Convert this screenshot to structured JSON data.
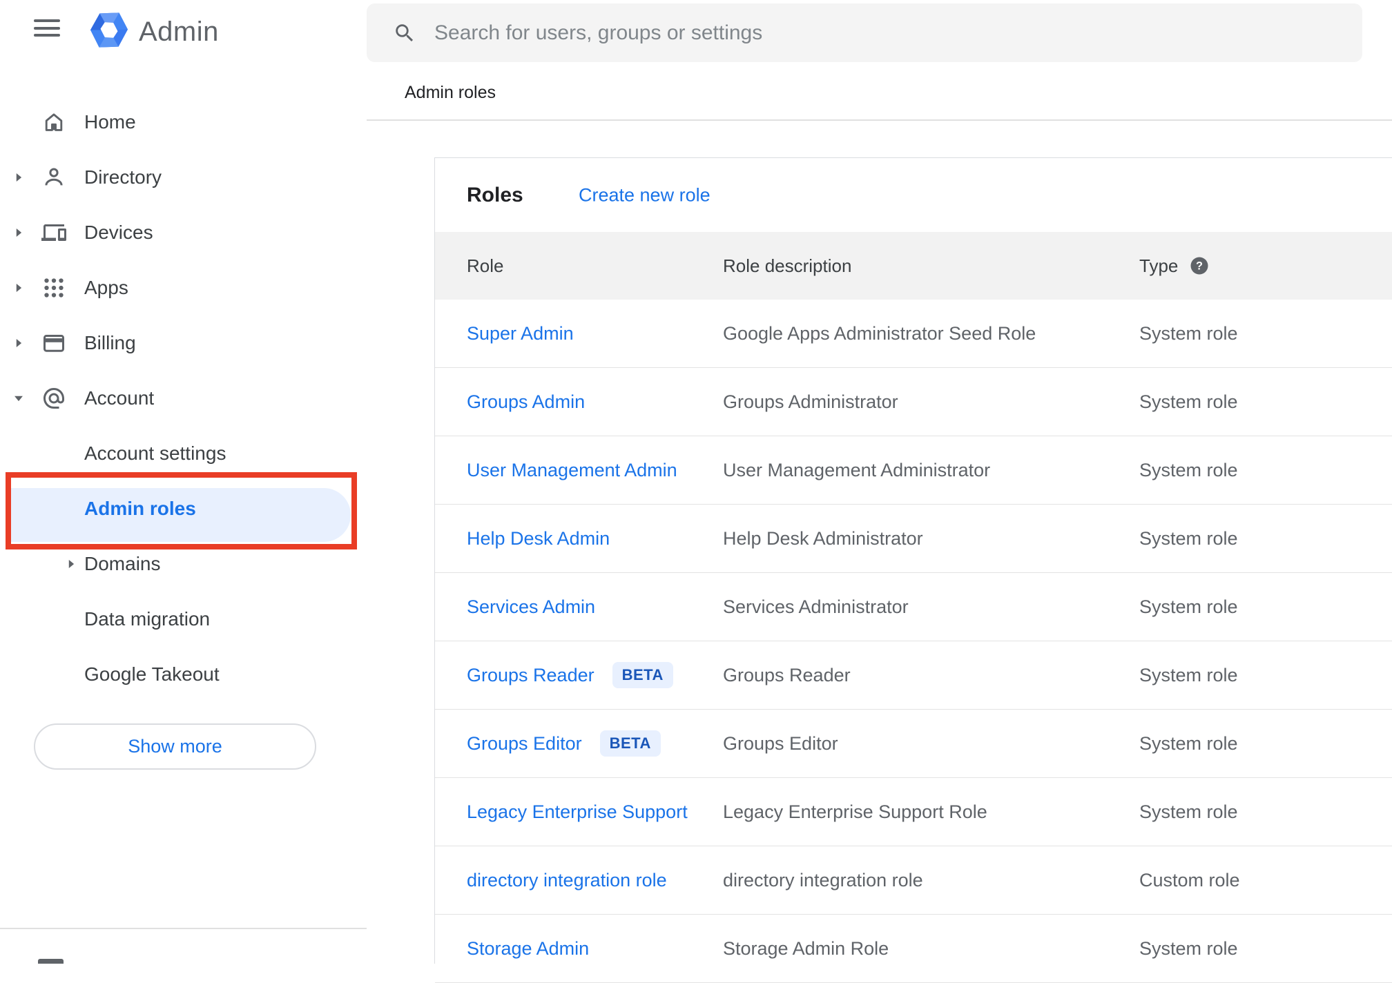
{
  "sidebar": {
    "logo_label": "Admin",
    "items": [
      {
        "label": "Home",
        "icon": "home",
        "caret": null,
        "level": 0,
        "active": false
      },
      {
        "label": "Directory",
        "icon": "person",
        "caret": "right",
        "level": 0,
        "active": false
      },
      {
        "label": "Devices",
        "icon": "devices",
        "caret": "right",
        "level": 0,
        "active": false
      },
      {
        "label": "Apps",
        "icon": "apps",
        "caret": "right",
        "level": 0,
        "active": false
      },
      {
        "label": "Billing",
        "icon": "billing",
        "caret": "right",
        "level": 0,
        "active": false
      },
      {
        "label": "Account",
        "icon": "at",
        "caret": "down",
        "level": 0,
        "active": false
      },
      {
        "label": "Account settings",
        "icon": null,
        "caret": null,
        "level": 1,
        "active": false
      },
      {
        "label": "Admin roles",
        "icon": null,
        "caret": null,
        "level": 1,
        "active": true
      },
      {
        "label": "Domains",
        "icon": null,
        "caret": "right",
        "level": 1,
        "active": false
      },
      {
        "label": "Data migration",
        "icon": null,
        "caret": null,
        "level": 1,
        "active": false
      },
      {
        "label": "Google Takeout",
        "icon": null,
        "caret": null,
        "level": 1,
        "active": false
      }
    ],
    "show_more_label": "Show more"
  },
  "topbar": {
    "search_placeholder": "Search for users, groups or settings"
  },
  "breadcrumb": "Admin roles",
  "main": {
    "title": "Roles",
    "create_link": "Create new role",
    "table": {
      "columns": [
        "Role",
        "Role description",
        "Type"
      ],
      "beta_label": "BETA",
      "rows": [
        {
          "role": "Super Admin",
          "beta": false,
          "description": "Google Apps Administrator Seed Role",
          "type": "System role"
        },
        {
          "role": "Groups Admin",
          "beta": false,
          "description": "Groups Administrator",
          "type": "System role"
        },
        {
          "role": "User Management Admin",
          "beta": false,
          "description": "User Management Administrator",
          "type": "System role"
        },
        {
          "role": "Help Desk Admin",
          "beta": false,
          "description": "Help Desk Administrator",
          "type": "System role"
        },
        {
          "role": "Services Admin",
          "beta": false,
          "description": "Services Administrator",
          "type": "System role"
        },
        {
          "role": "Groups Reader",
          "beta": true,
          "description": "Groups Reader",
          "type": "System role"
        },
        {
          "role": "Groups Editor",
          "beta": true,
          "description": "Groups Editor",
          "type": "System role"
        },
        {
          "role": "Legacy Enterprise Support",
          "beta": false,
          "description": "Legacy Enterprise Support Role",
          "type": "System role"
        },
        {
          "role": "directory integration role",
          "beta": false,
          "description": "directory integration role",
          "type": "Custom role"
        },
        {
          "role": "Storage Admin",
          "beta": false,
          "description": "Storage Admin Role",
          "type": "System role"
        }
      ]
    }
  },
  "colors": {
    "accent_blue": "#1a73e8",
    "highlight_bg": "#e8f0fe",
    "annotation_red": "#e93d26",
    "beta_text": "#1a56b8",
    "text_dark": "#202124",
    "text_gray": "#5f6368",
    "header_bg": "#f2f2f2",
    "searchbar_bg": "#f4f4f4"
  }
}
